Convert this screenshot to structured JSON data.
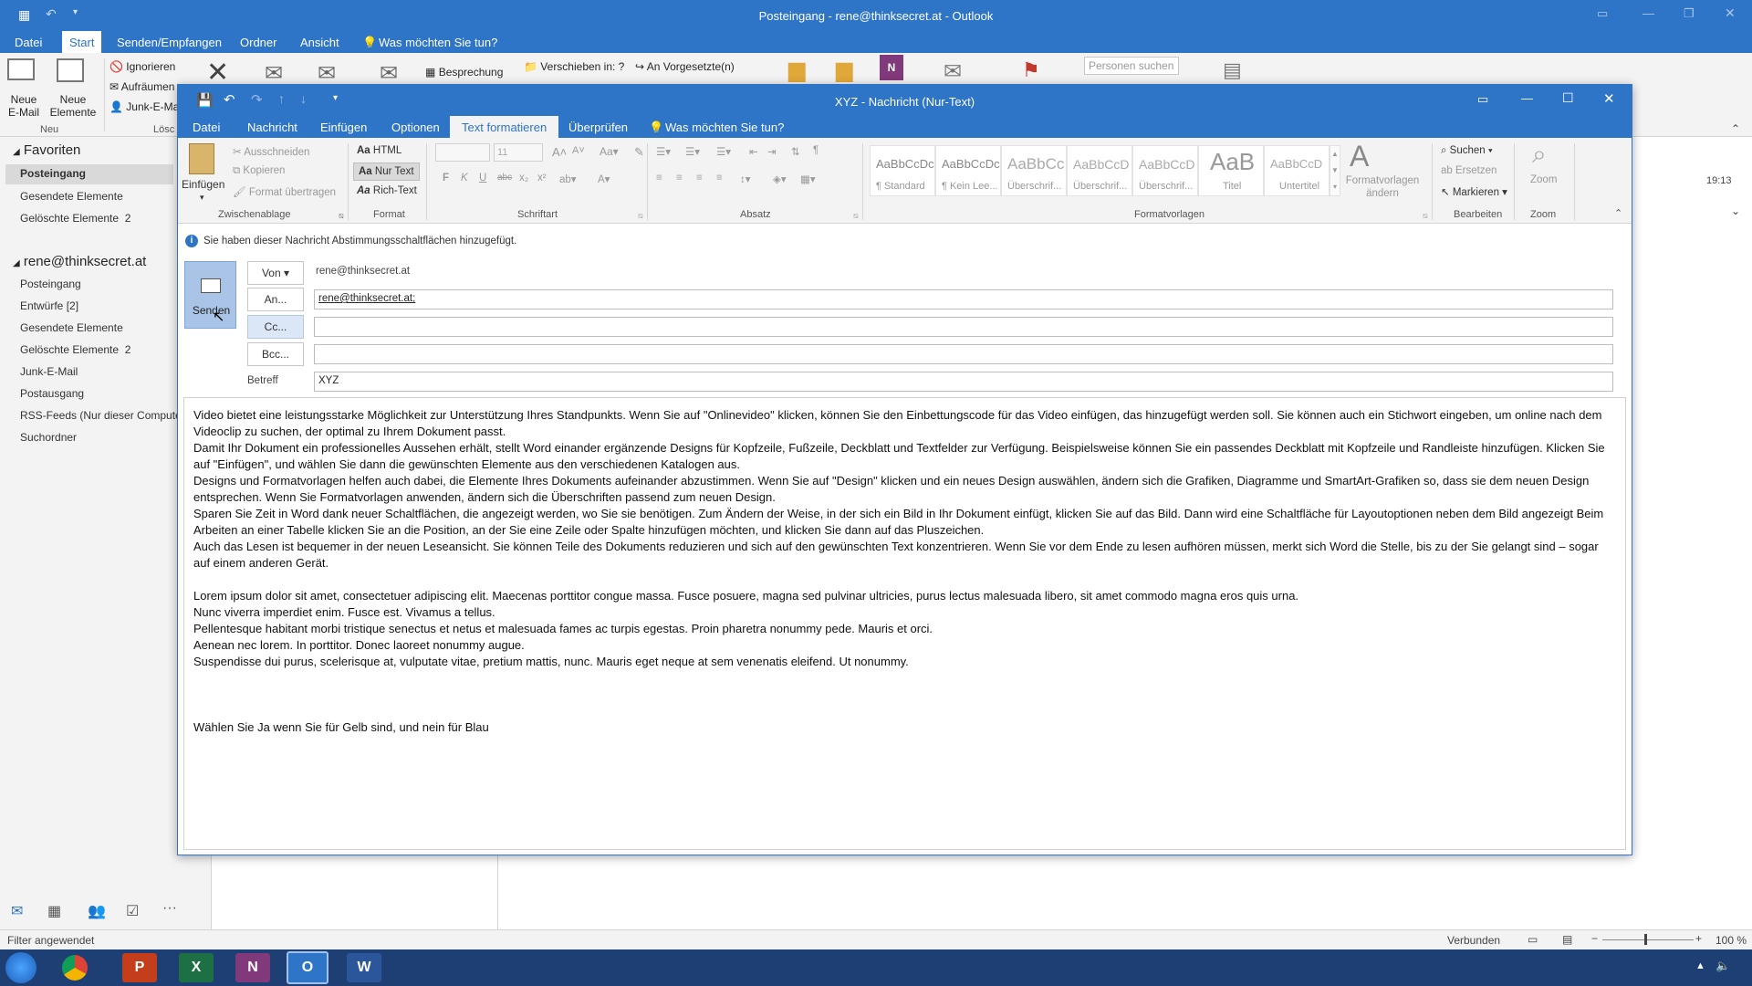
{
  "outlook": {
    "window_title": "Posteingang - rene@thinksecret.at - Outlook",
    "tabs": [
      "Datei",
      "Start",
      "Senden/Empfangen",
      "Ordner",
      "Ansicht"
    ],
    "tell_me": "Was möchten Sie tun?",
    "ribbon": {
      "neue_email": "Neue E-Mail",
      "neue_elemente": "Neue Elemente",
      "group_neu": "Neu",
      "ignorieren": "Ignorieren",
      "aufraeumen": "Aufräumen",
      "junk": "Junk-E-Mail",
      "group_loeschen": "Lösc",
      "besprechung": "Besprechung",
      "verschieben": "Verschieben in: ?",
      "an_vorgesetzte": "An Vorgesetzte(n)",
      "personen_suchen": "Personen suchen"
    },
    "nav": {
      "favoriten": "Favoriten",
      "fav_items": [
        {
          "label": "Posteingang"
        },
        {
          "label": "Gesendete Elemente"
        },
        {
          "label": "Gelöschte Elemente",
          "count": "2"
        }
      ],
      "account": "rene@thinksecret.at",
      "account_items": [
        {
          "label": "Posteingang"
        },
        {
          "label": "Entwürfe [2]"
        },
        {
          "label": "Gesendete Elemente"
        },
        {
          "label": "Gelöschte Elemente",
          "count": "2"
        },
        {
          "label": "Junk-E-Mail"
        },
        {
          "label": "Postausgang"
        },
        {
          "label": "RSS-Feeds (Nur dieser Computer)"
        },
        {
          "label": "Suchordner"
        }
      ]
    },
    "time": "19:13",
    "status": {
      "filter": "Filter angewendet",
      "connected": "Verbunden",
      "zoom": "100 %"
    }
  },
  "message": {
    "window_title": "XYZ - Nachricht (Nur-Text)",
    "tabs": [
      "Datei",
      "Nachricht",
      "Einfügen",
      "Optionen",
      "Text formatieren",
      "Überprüfen"
    ],
    "tell_me": "Was möchten Sie tun?",
    "ribbon": {
      "einfuegen": "Einfügen",
      "ausschneiden": "Ausschneiden",
      "kopieren": "Kopieren",
      "format_uebertragen": "Format übertragen",
      "group_zwischenablage": "Zwischenablage",
      "html": "HTML",
      "nur_text": "Nur Text",
      "rich_text": "Rich-Text",
      "group_format": "Format",
      "font_size": "11",
      "group_schriftart": "Schriftart",
      "group_absatz": "Absatz",
      "styles": [
        {
          "preview": "AaBbCcDc",
          "name": "¶ Standard"
        },
        {
          "preview": "AaBbCcDc",
          "name": "¶ Kein Lee..."
        },
        {
          "preview": "AaBbCc",
          "name": "Überschrif..."
        },
        {
          "preview": "AaBbCcD",
          "name": "Überschrif..."
        },
        {
          "preview": "AaBbCcD",
          "name": "Überschrif..."
        },
        {
          "preview": "AaB",
          "name": "Titel"
        },
        {
          "preview": "AaBbCcD",
          "name": "Untertitel"
        }
      ],
      "formatvorlagen_aendern": "Formatvorlagen ändern",
      "group_formatvorlagen": "Formatvorlagen",
      "suchen": "Suchen",
      "ersetzen": "Ersetzen",
      "markieren": "Markieren",
      "group_bearbeiten": "Bearbeiten",
      "zoom": "Zoom",
      "group_zoom": "Zoom"
    },
    "info": "Sie haben dieser Nachricht Abstimmungsschaltflächen hinzugefügt.",
    "send": "Senden",
    "from_label": "Von",
    "from_value": "rene@thinksecret.at",
    "to_label": "An...",
    "to_value": "rene@thinksecret.at;",
    "cc_label": "Cc...",
    "cc_value": "",
    "bcc_label": "Bcc...",
    "bcc_value": "",
    "subject_label": "Betreff",
    "subject_value": "XYZ",
    "body": "Video bietet eine leistungsstarke Möglichkeit zur Unterstützung Ihres Standpunkts. Wenn Sie auf \"Onlinevideo\" klicken, können Sie den Einbettungscode für das Video einfügen, das hinzugefügt werden soll. Sie können auch ein Stichwort eingeben, um online nach dem Videoclip zu suchen, der optimal zu Ihrem Dokument passt.\nDamit Ihr Dokument ein professionelles Aussehen erhält, stellt Word einander ergänzende Designs für Kopfzeile, Fußzeile, Deckblatt und Textfelder zur Verfügung. Beispielsweise können Sie ein passendes Deckblatt mit Kopfzeile und Randleiste hinzufügen. Klicken Sie auf \"Einfügen\", und wählen Sie dann die gewünschten Elemente aus den verschiedenen Katalogen aus.\nDesigns und Formatvorlagen helfen auch dabei, die Elemente Ihres Dokuments aufeinander abzustimmen. Wenn Sie auf \"Design\" klicken und ein neues Design auswählen, ändern sich die Grafiken, Diagramme und SmartArt-Grafiken so, dass sie dem neuen Design entsprechen. Wenn Sie Formatvorlagen anwenden, ändern sich die Überschriften passend zum neuen Design.\nSparen Sie Zeit in Word dank neuer Schaltflächen, die angezeigt werden, wo Sie sie benötigen. Zum Ändern der Weise, in der sich ein Bild in Ihr Dokument einfügt, klicken Sie auf das Bild. Dann wird eine Schaltfläche für Layoutoptionen neben dem Bild angezeigt Beim Arbeiten an einer Tabelle klicken Sie an die Position, an der Sie eine Zeile oder Spalte hinzufügen möchten, und klicken Sie dann auf das Pluszeichen.\nAuch das Lesen ist bequemer in der neuen Leseansicht. Sie können Teile des Dokuments reduzieren und sich auf den gewünschten Text konzentrieren. Wenn Sie vor dem Ende zu lesen aufhören müssen, merkt sich Word die Stelle, bis zu der Sie gelangt sind – sogar auf einem anderen Gerät.\n\nLorem ipsum dolor sit amet, consectetuer adipiscing elit. Maecenas porttitor congue massa. Fusce posuere, magna sed pulvinar ultricies, purus lectus malesuada libero, sit amet commodo magna eros quis urna.\nNunc viverra imperdiet enim. Fusce est. Vivamus a tellus.\nPellentesque habitant morbi tristique senectus et netus et malesuada fames ac turpis egestas. Proin pharetra nonummy pede. Mauris et orci.\nAenean nec lorem. In porttitor. Donec laoreet nonummy augue.\nSuspendisse dui purus, scelerisque at, vulputate vitae, pretium mattis, nunc. Mauris eget neque at sem venenatis eleifend. Ut nonummy.\n\n\n\nWählen Sie Ja wenn Sie für Gelb sind, und nein für Blau"
  },
  "taskbar": [
    "start-icon",
    "chrome-icon",
    "powerpoint-icon",
    "excel-icon",
    "onenote-icon",
    "outlook-icon",
    "word-icon"
  ],
  "colors": {
    "accent": "#2e74c7",
    "taskbar": "#1d3f73"
  }
}
